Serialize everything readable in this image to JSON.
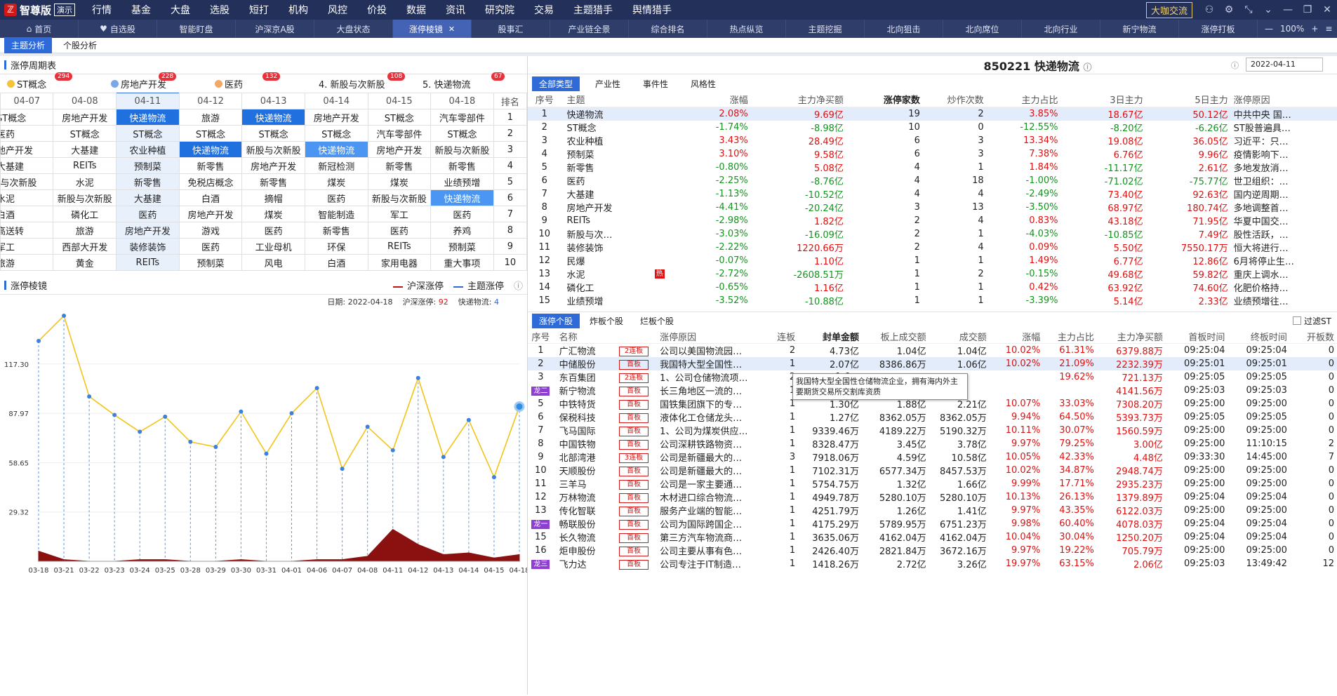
{
  "menubar": {
    "logo_text": "智尊版",
    "logo_demo": "演示",
    "items": [
      "行情",
      "基金",
      "大盘",
      "选股",
      "短打",
      "机构",
      "风控",
      "价投",
      "数据",
      "资讯",
      "研究院",
      "交易",
      "主题猎手",
      "舆情猎手"
    ],
    "right_button": "大咖交流"
  },
  "tabs": [
    {
      "label": "首页",
      "icon": "⌂"
    },
    {
      "label": "自选股",
      "icon": "♥"
    },
    {
      "label": "智能盯盘"
    },
    {
      "label": "沪深京A股"
    },
    {
      "label": "大盘状态"
    },
    {
      "label": "涨停棱镜",
      "active": true
    },
    {
      "label": "股事汇"
    },
    {
      "label": "产业链全景"
    },
    {
      "label": "综合排名"
    },
    {
      "label": "热点纵览"
    },
    {
      "label": "主题挖掘"
    },
    {
      "label": "北向狙击"
    },
    {
      "label": "北向席位"
    },
    {
      "label": "北向行业"
    },
    {
      "label": "新宁物流"
    },
    {
      "label": "涨停打板"
    }
  ],
  "zoom": "100%",
  "subtabs": [
    "主题分析",
    "个股分析"
  ],
  "cycle": {
    "title": "涨停周期表",
    "themes": [
      {
        "name": "ST概念",
        "count": "294",
        "color": "#f3c33b"
      },
      {
        "name": "房地产开发",
        "count": "228",
        "color": "#7aa7e8"
      },
      {
        "name": "医药",
        "count": "132",
        "color": "#f2a868"
      },
      {
        "name": "4. 新股与次新股",
        "count": "108"
      },
      {
        "name": "5. 快递物流",
        "count": "67"
      }
    ],
    "headers": [
      "04-07",
      "04-08",
      "04-11",
      "04-12",
      "04-13",
      "04-14",
      "04-15",
      "04-18",
      "排名"
    ],
    "rows": [
      [
        "ST概念",
        "房地产开发",
        "快递物流",
        "旅游",
        "快递物流",
        "房地产开发",
        "ST概念",
        "汽车零部件",
        "1"
      ],
      [
        "医药",
        "ST概念",
        "ST概念",
        "ST概念",
        "ST概念",
        "ST概念",
        "汽车零部件",
        "ST概念",
        "2"
      ],
      [
        "地产开发",
        "大基建",
        "农业种植",
        "快递物流",
        "新股与次新股",
        "快递物流",
        "房地产开发",
        "新股与次新股",
        "3"
      ],
      [
        "大基建",
        "REITs",
        "预制菜",
        "新零售",
        "房地产开发",
        "新冠检测",
        "新零售",
        "新零售",
        "4"
      ],
      [
        "r与次新股",
        "水泥",
        "新零售",
        "免税店概念",
        "新零售",
        "煤炭",
        "煤炭",
        "业绩预增",
        "5"
      ],
      [
        "水泥",
        "新股与次新股",
        "大基建",
        "白酒",
        "摘帽",
        "医药",
        "新股与次新股",
        "快递物流",
        "6"
      ],
      [
        "白酒",
        "磷化工",
        "医药",
        "房地产开发",
        "煤炭",
        "智能制造",
        "军工",
        "医药",
        "7"
      ],
      [
        "高送转",
        "旅游",
        "房地产开发",
        "游戏",
        "医药",
        "新零售",
        "医药",
        "养鸡",
        "8"
      ],
      [
        "军工",
        "西部大开发",
        "装修装饰",
        "医药",
        "工业母机",
        "环保",
        "REITs",
        "预制菜",
        "9"
      ],
      [
        "旅游",
        "黄金",
        "REITs",
        "预制菜",
        "风电",
        "白酒",
        "家用电器",
        "重大事项",
        "10"
      ]
    ]
  },
  "chart": {
    "title": "涨停棱镜",
    "legend_a": "沪深涨停",
    "legend_b": "主题涨停",
    "info_date_label": "日期:",
    "info_date": "2022-04-18",
    "info_a_label": "沪深涨停:",
    "info_a": "92",
    "info_b_label": "快递物流:",
    "info_b": "4"
  },
  "chart_data": {
    "type": "line",
    "x": [
      "03-18",
      "03-21",
      "03-22",
      "03-23",
      "03-24",
      "03-25",
      "03-28",
      "03-29",
      "03-30",
      "03-31",
      "04-01",
      "04-06",
      "04-07",
      "04-08",
      "04-11",
      "04-12",
      "04-13",
      "04-14",
      "04-15",
      "04-18"
    ],
    "y_ticks": [
      "29.32",
      "58.65",
      "87.97",
      "117.30"
    ],
    "ylim": [
      0,
      146
    ],
    "series": [
      {
        "name": "沪深涨停",
        "values": [
          131,
          146,
          98,
          87,
          77,
          86,
          71,
          68,
          89,
          64,
          88,
          103,
          55,
          80,
          66,
          109,
          62,
          84,
          50,
          92
        ]
      },
      {
        "name": "主题涨停",
        "values": [
          6,
          1,
          0,
          0,
          1,
          1,
          0,
          0,
          1,
          0,
          0,
          1,
          1,
          3,
          19,
          10,
          4,
          5,
          2,
          4
        ]
      }
    ]
  },
  "right": {
    "code": "850221",
    "name": "快递物流",
    "date": "2022-04-11",
    "type_tabs": [
      "全部类型",
      "产业性",
      "事件性",
      "风格性"
    ],
    "theme_headers": [
      "序号",
      "主题",
      "涨幅",
      "主力净买额",
      "涨停家数",
      "炒作次数",
      "主力占比",
      "3日主力",
      "5日主力",
      "涨停原因"
    ],
    "themes": [
      [
        "1",
        "快递物流",
        "2.08%",
        "9.69亿",
        "19",
        "2",
        "3.85%",
        "18.67亿",
        "50.12亿",
        "中共中央 国…"
      ],
      [
        "2",
        "ST概念",
        "-1.74%",
        "-8.98亿",
        "10",
        "0",
        "-12.55%",
        "-8.20亿",
        "-6.26亿",
        "ST股普遍具…"
      ],
      [
        "3",
        "农业种植",
        "3.43%",
        "28.49亿",
        "6",
        "3",
        "13.34%",
        "19.08亿",
        "36.05亿",
        "习近平：只…"
      ],
      [
        "4",
        "预制菜",
        "3.10%",
        "9.58亿",
        "6",
        "3",
        "7.38%",
        "6.76亿",
        "9.96亿",
        "疫情影响下…"
      ],
      [
        "5",
        "新零售",
        "-0.80%",
        "5.08亿",
        "4",
        "1",
        "1.84%",
        "-11.17亿",
        "2.61亿",
        "多地发放消…"
      ],
      [
        "6",
        "医药",
        "-2.25%",
        "-8.76亿",
        "4",
        "18",
        "-1.00%",
        "-71.02亿",
        "-75.77亿",
        "世卫组织：…"
      ],
      [
        "7",
        "大基建",
        "-1.13%",
        "-10.52亿",
        "4",
        "4",
        "-2.49%",
        "73.40亿",
        "92.63亿",
        "国内逆周期…"
      ],
      [
        "8",
        "房地产开发",
        "-4.41%",
        "-20.24亿",
        "3",
        "13",
        "-3.50%",
        "68.97亿",
        "180.74亿",
        "多地调整首…"
      ],
      [
        "9",
        "REITs",
        "-2.98%",
        "1.82亿",
        "2",
        "4",
        "0.83%",
        "43.18亿",
        "71.95亿",
        "华夏中国交…"
      ],
      [
        "10",
        "新股与次…",
        "-3.03%",
        "-16.09亿",
        "2",
        "1",
        "-4.03%",
        "-10.85亿",
        "7.49亿",
        "股性活跃，…"
      ],
      [
        "11",
        "装修装饰",
        "-2.22%",
        "1220.66万",
        "2",
        "4",
        "0.09%",
        "5.50亿",
        "7550.17万",
        "恒大将进行…"
      ],
      [
        "12",
        "民爆",
        "-0.07%",
        "1.10亿",
        "1",
        "1",
        "1.49%",
        "6.77亿",
        "12.86亿",
        "6月将停止生…"
      ],
      [
        "13",
        "水泥",
        "-2.72%",
        "-2608.51万",
        "1",
        "2",
        "-0.15%",
        "49.68亿",
        "59.82亿",
        "重庆上调水…"
      ],
      [
        "14",
        "磷化工",
        "-0.65%",
        "1.16亿",
        "1",
        "1",
        "0.42%",
        "63.92亿",
        "74.60亿",
        "化肥价格持…"
      ],
      [
        "15",
        "业绩预增",
        "-3.52%",
        "-10.88亿",
        "1",
        "1",
        "-3.39%",
        "5.14亿",
        "2.33亿",
        "业绩预增往…"
      ]
    ],
    "hot_label": "热",
    "stock_tabs": [
      "涨停个股",
      "炸板个股",
      "烂板个股"
    ],
    "filter_label": "过滤ST",
    "stock_headers": [
      "序号",
      "名称",
      "",
      "涨停原因",
      "连板",
      "封单金额",
      "板上成交额",
      "成交额",
      "涨幅",
      "主力占比",
      "主力净买额",
      "首板时间",
      "终板时间",
      "开板数"
    ],
    "stocks": [
      [
        "1",
        "广汇物流",
        "2连板",
        "公司以美国物流园…",
        "2",
        "4.73亿",
        "1.04亿",
        "1.04亿",
        "10.02%",
        "61.31%",
        "6379.88万",
        "09:25:04",
        "09:25:04",
        "0",
        ""
      ],
      [
        "2",
        "中储股份",
        "首板",
        "我国特大型全国性…",
        "1",
        "2.07亿",
        "8386.86万",
        "1.06亿",
        "10.02%",
        "21.09%",
        "2232.39万",
        "09:25:01",
        "09:25:01",
        "0",
        ""
      ],
      [
        "3",
        "东百集团",
        "2连板",
        "1、公司仓储物流项…",
        "2",
        "1.6…",
        "",
        "",
        "",
        "19.62%",
        "721.13万",
        "09:25:05",
        "09:25:05",
        "0",
        ""
      ],
      [
        "4",
        "新宁物流",
        "首板",
        "长三角地区一流的…",
        "1",
        "1.3…",
        "",
        "",
        "",
        "",
        "4141.56万",
        "09:25:03",
        "09:25:03",
        "0",
        "龙二"
      ],
      [
        "5",
        "中铁特货",
        "首板",
        "国铁集团旗下的专…",
        "1",
        "1.30亿",
        "1.88亿",
        "2.21亿",
        "10.07%",
        "33.03%",
        "7308.20万",
        "09:25:00",
        "09:25:00",
        "0",
        ""
      ],
      [
        "6",
        "保税科技",
        "首板",
        "液体化工仓储龙头…",
        "1",
        "1.27亿",
        "8362.05万",
        "8362.05万",
        "9.94%",
        "64.50%",
        "5393.73万",
        "09:25:05",
        "09:25:05",
        "0",
        ""
      ],
      [
        "7",
        "飞马国际",
        "首板",
        "1、公司为煤炭供应…",
        "1",
        "9339.46万",
        "4189.22万",
        "5190.32万",
        "10.11%",
        "30.07%",
        "1560.59万",
        "09:25:00",
        "09:25:00",
        "0",
        ""
      ],
      [
        "8",
        "中国铁物",
        "首板",
        "公司深耕铁路物资…",
        "1",
        "8328.47万",
        "3.45亿",
        "3.78亿",
        "9.97%",
        "79.25%",
        "3.00亿",
        "09:25:00",
        "11:10:15",
        "2",
        ""
      ],
      [
        "9",
        "北部湾港",
        "3连板",
        "公司是新疆最大的…",
        "3",
        "7918.06万",
        "4.59亿",
        "10.58亿",
        "10.05%",
        "42.33%",
        "4.48亿",
        "09:33:30",
        "14:45:00",
        "7",
        ""
      ],
      [
        "10",
        "天顺股份",
        "首板",
        "公司是新疆最大的…",
        "1",
        "7102.31万",
        "6577.34万",
        "8457.53万",
        "10.02%",
        "34.87%",
        "2948.74万",
        "09:25:00",
        "09:25:00",
        "0",
        ""
      ],
      [
        "11",
        "三羊马",
        "首板",
        "公司是一家主要通…",
        "1",
        "5754.75万",
        "1.32亿",
        "1.66亿",
        "9.99%",
        "17.71%",
        "2935.23万",
        "09:25:00",
        "09:25:00",
        "0",
        ""
      ],
      [
        "12",
        "万林物流",
        "首板",
        "木材进口综合物流…",
        "1",
        "4949.78万",
        "5280.10万",
        "5280.10万",
        "10.13%",
        "26.13%",
        "1379.89万",
        "09:25:04",
        "09:25:04",
        "0",
        ""
      ],
      [
        "13",
        "传化智联",
        "首板",
        "服务产业端的智能…",
        "1",
        "4251.79万",
        "1.26亿",
        "1.41亿",
        "9.97%",
        "43.35%",
        "6122.03万",
        "09:25:00",
        "09:25:00",
        "0",
        ""
      ],
      [
        "14",
        "畅联股份",
        "首板",
        "公司为国际跨国企…",
        "1",
        "4175.29万",
        "5789.95万",
        "6751.23万",
        "9.98%",
        "60.40%",
        "4078.03万",
        "09:25:04",
        "09:25:04",
        "0",
        "龙一"
      ],
      [
        "15",
        "长久物流",
        "首板",
        "第三方汽车物流商…",
        "1",
        "3635.06万",
        "4162.04万",
        "4162.04万",
        "10.04%",
        "30.04%",
        "1250.20万",
        "09:25:04",
        "09:25:04",
        "0",
        ""
      ],
      [
        "16",
        "炬申股份",
        "首板",
        "公司主要从事有色…",
        "1",
        "2426.40万",
        "2821.84万",
        "3672.16万",
        "9.97%",
        "19.22%",
        "705.79万",
        "09:25:00",
        "09:25:00",
        "0",
        ""
      ],
      [
        "17",
        "飞力达",
        "首板",
        "公司专注于IT制造…",
        "1",
        "1418.26万",
        "2.72亿",
        "3.26亿",
        "19.97%",
        "63.15%",
        "2.06亿",
        "09:25:03",
        "13:49:42",
        "12",
        "龙三"
      ]
    ],
    "tooltip": "我国特大型全国性仓储物流企业，拥有海内外主要期货交易所交割库资质"
  }
}
